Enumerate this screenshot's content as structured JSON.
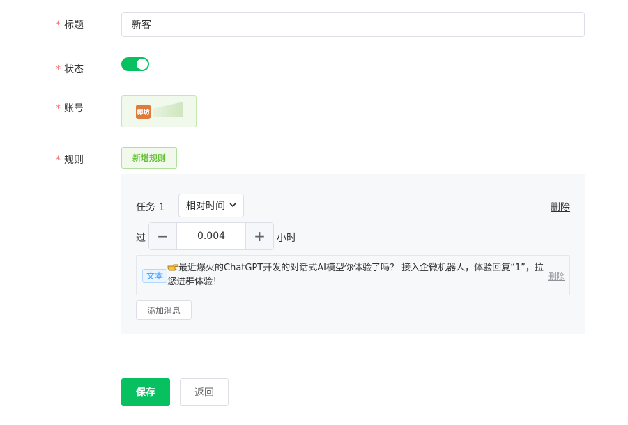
{
  "form": {
    "required_mark": "*",
    "title_label": "标题",
    "title_value": "新客",
    "status_label": "状态",
    "status_on": true,
    "account_label": "账号",
    "account_avatar_text": "椰坊",
    "rules_label": "规则",
    "add_rule_label": "新增规则"
  },
  "rule": {
    "task_label": "任务 1",
    "time_mode": "相对时间",
    "delete_label": "删除",
    "after_label": "过",
    "minus_symbol": "−",
    "plus_symbol": "+",
    "duration_value": "0.004",
    "unit_label": "小时",
    "message": {
      "type_tag": "文本",
      "text": "最近爆火的ChatGPT开发的对话式AI模型你体验了吗？ 接入企微机器人，体验回复“1”，拉您进群体验！",
      "delete_label": "删除"
    },
    "add_message_label": "添加消息"
  },
  "actions": {
    "save_label": "保存",
    "back_label": "返回"
  },
  "colors": {
    "primary_green": "#07c160",
    "required_red": "#f56c6c",
    "tag_blue": "#409eff"
  }
}
